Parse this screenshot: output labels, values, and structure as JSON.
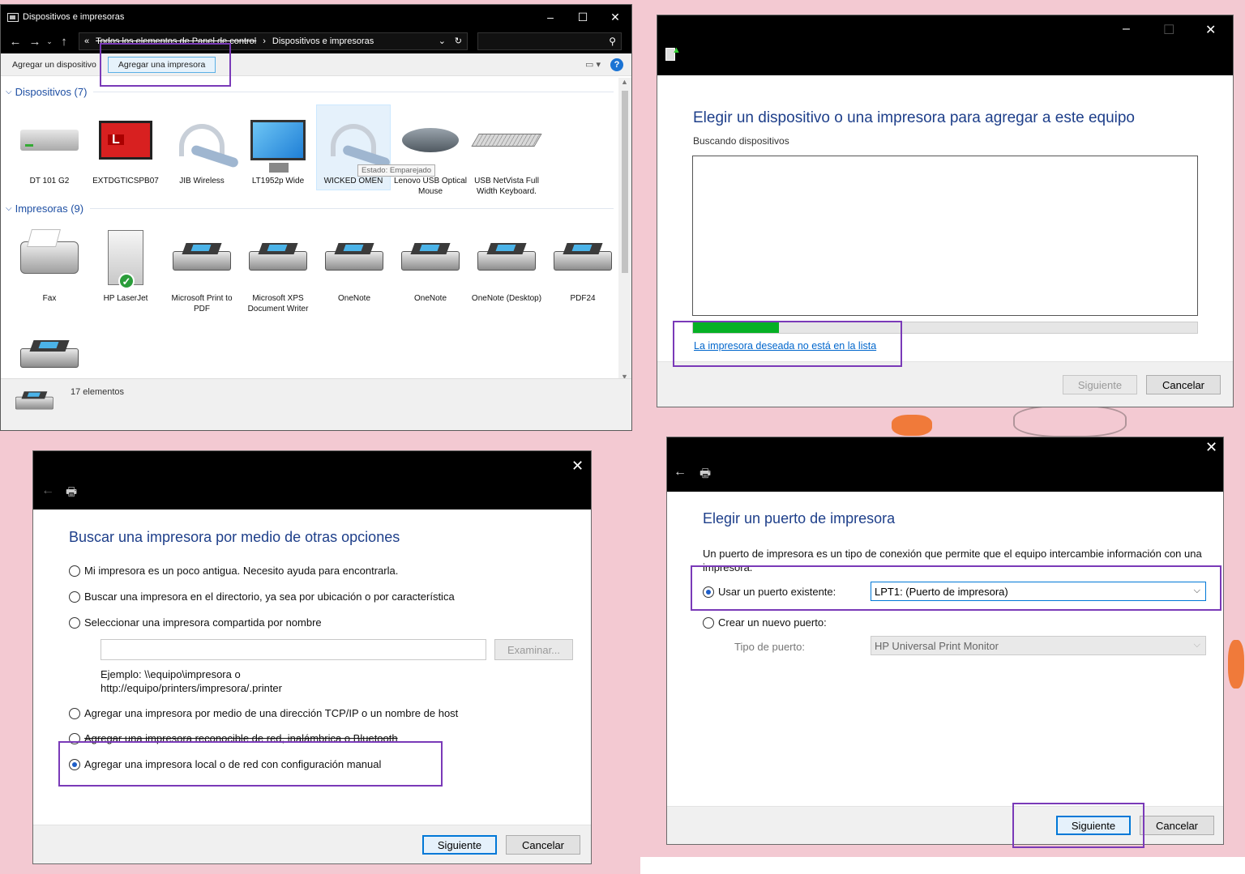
{
  "explorer": {
    "title": "Dispositivos e impresoras",
    "controls": {
      "minimize": "–",
      "maximize": "☐",
      "close": "✕"
    },
    "breadcrumb": {
      "chevrons": "«",
      "root": "Todos los elementos de Panel de control",
      "separator": "›",
      "current": "Dispositivos e impresoras"
    },
    "commands": {
      "add_device": "Agregar un dispositivo",
      "add_printer": "Agregar una impresora"
    },
    "help": "?",
    "devices_header": "Dispositivos (7)",
    "printers_header": "Impresoras (9)",
    "devices": [
      {
        "label": "DT 101 G2"
      },
      {
        "label": "EXTDGTICSPB07"
      },
      {
        "label": "JIB Wireless"
      },
      {
        "label": "LT1952p Wide"
      },
      {
        "label": "WICKED OMEN"
      },
      {
        "label": "Lenovo USB Optical Mouse"
      },
      {
        "label": "USB NetVista Full Width Keyboard."
      }
    ],
    "tooltip": "Estado: Emparejado",
    "printers": [
      {
        "label": "Fax"
      },
      {
        "label": "HP LaserJet"
      },
      {
        "label": "Microsoft Print to PDF"
      },
      {
        "label": "Microsoft XPS Document Writer"
      },
      {
        "label": "OneNote"
      },
      {
        "label": "OneNote"
      },
      {
        "label": "OneNote (Desktop)"
      },
      {
        "label": "PDF24"
      }
    ],
    "laptop_letter": "L",
    "check": "✓",
    "item_count": "17 elementos"
  },
  "dialog_choose_device": {
    "heading": "Elegir un dispositivo o una impresora para agregar a este equipo",
    "subtitle": "Buscando dispositivos",
    "progress": 0.17,
    "link": "La impresora deseada no está en la lista",
    "next": "Siguiente",
    "cancel": "Cancelar"
  },
  "dialog_other_options": {
    "heading": "Buscar una impresora por medio de otras opciones",
    "options": [
      "Mi impresora es un poco antigua. Necesito ayuda para encontrarla.",
      "Buscar una impresora en el directorio, ya sea por ubicación o por característica",
      "Seleccionar una impresora compartida por nombre",
      "Agregar una impresora por medio de una dirección TCP/IP o un nombre de host",
      "Agregar una impresora reconocible de red, inalámbrica o Bluetooth",
      "Agregar una impresora local o de red con configuración manual"
    ],
    "selected_index": 5,
    "browse": "Examinar...",
    "example_line1": "Ejemplo: \\\\equipo\\impresora o",
    "example_line2": "http://equipo/printers/impresora/.printer",
    "next": "Siguiente",
    "cancel": "Cancelar"
  },
  "dialog_port": {
    "heading": "Elegir un puerto de impresora",
    "description": "Un puerto de impresora es un tipo de conexión que permite que el equipo intercambie información con una impresora.",
    "use_existing": "Usar un puerto existente:",
    "existing_value": "LPT1: (Puerto de impresora)",
    "create_new": "Crear un nuevo puerto:",
    "port_type_label": "Tipo de puerto:",
    "port_type_value": "HP Universal Print Monitor",
    "next": "Siguiente",
    "cancel": "Cancelar"
  },
  "colors": {
    "accent": "#0078d7",
    "highlight": "#7a3ab8",
    "heading": "#1e3f8a",
    "progress": "#06b025"
  }
}
